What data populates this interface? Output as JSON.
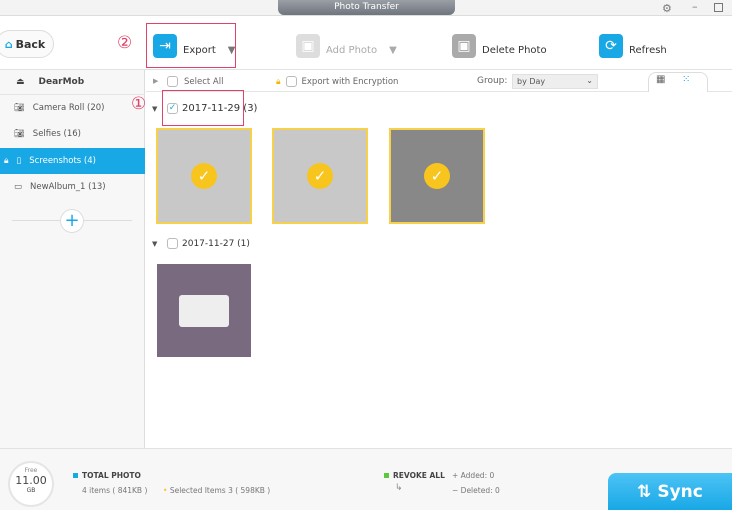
{
  "window": {
    "title": "Photo Transfer"
  },
  "toolbar": {
    "back": "Back",
    "step2": "②",
    "export": "Export",
    "add_photo": "Add Photo",
    "delete_photo": "Delete Photo",
    "refresh": "Refresh"
  },
  "sidebar": {
    "device": "DearMob",
    "items": [
      {
        "label": "Camera Roll (20)"
      },
      {
        "label": "Selfies (16)"
      },
      {
        "label": "Screenshots (4)"
      },
      {
        "label": "NewAlbum_1 (13)"
      }
    ]
  },
  "content": {
    "select_all": "Select All",
    "export_encryption": "Export with Encryption",
    "group_label": "Group:",
    "group_value": "by Day",
    "step1": "①",
    "groups": [
      {
        "date": "2017-11-29 (3)",
        "checked": true
      },
      {
        "date": "2017-11-27 (1)",
        "checked": false
      }
    ]
  },
  "bottom": {
    "free_label": "Free",
    "free_value": "11.00",
    "free_unit": "GB",
    "total_photo": "TOTAL PHOTO",
    "items": "4 items ( 841KB )",
    "selected": "Selected Items 3 ( 598KB )",
    "revoke_all": "REVOKE ALL",
    "added": "Added: 0",
    "deleted": "Deleted: 0",
    "sync": "Sync"
  },
  "colors": {
    "accent": "#19a8e6",
    "highlight": "#e0436a",
    "selected": "#f7c51e"
  }
}
